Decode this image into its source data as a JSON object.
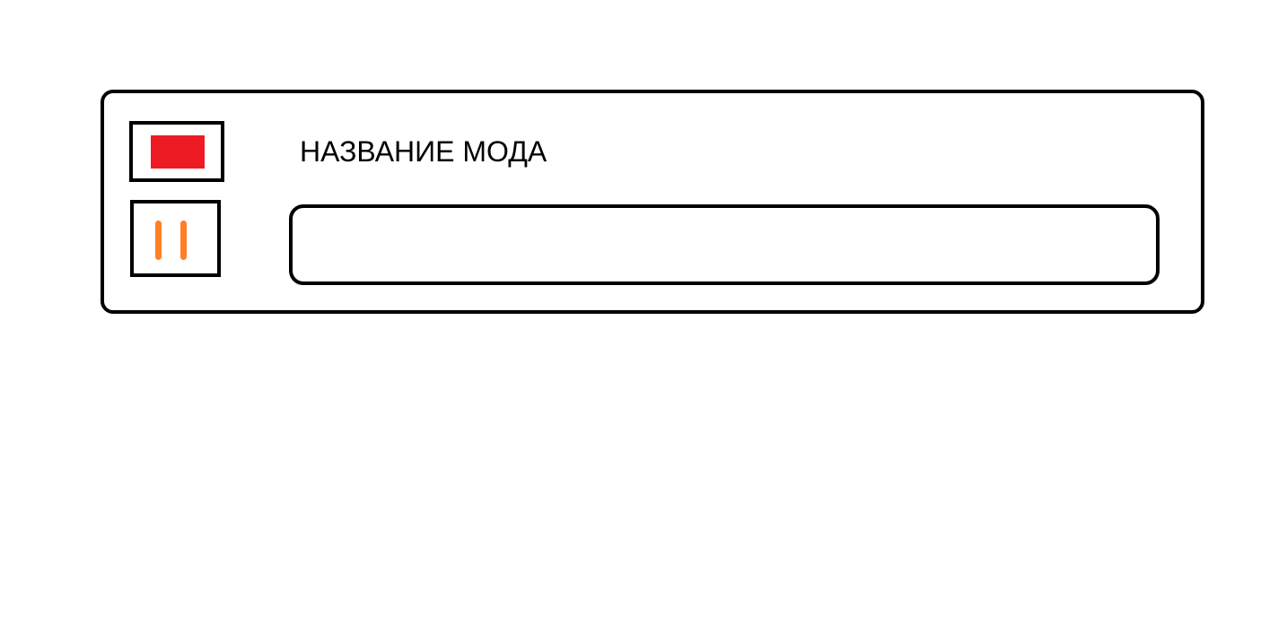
{
  "mod": {
    "title": "НАЗВАНИЕ МОДА",
    "progress": 0
  },
  "buttons": {
    "stop_icon": "stop-icon",
    "pause_icon": "pause-icon"
  },
  "colors": {
    "stop": "#ed1c24",
    "pause": "#ff7f27",
    "outline": "#000000",
    "background": "#ffffff"
  }
}
